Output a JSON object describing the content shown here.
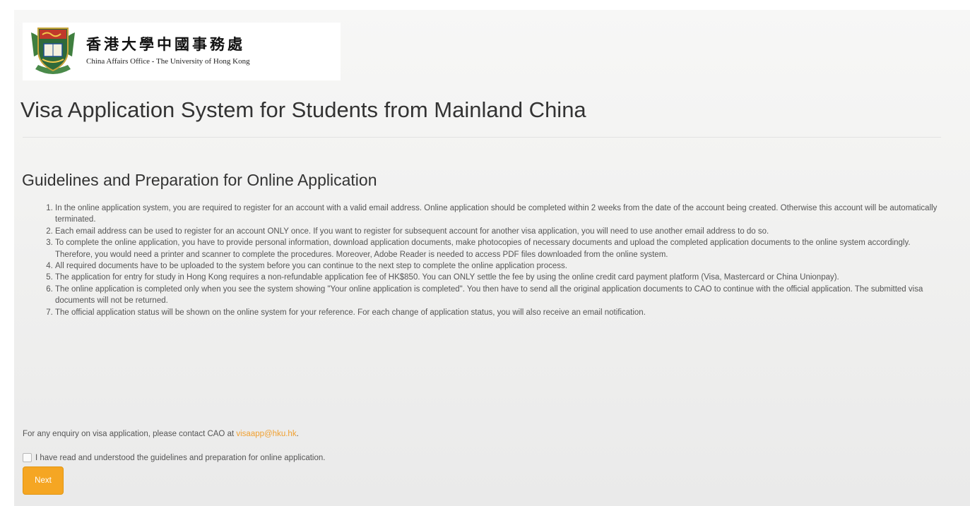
{
  "header": {
    "logo_chinese": "香港大學中國事務處",
    "logo_english": "China Affairs Office - The University of Hong Kong",
    "page_title": "Visa Application System for Students from Mainland China"
  },
  "main": {
    "section_heading": "Guidelines and Preparation for Online Application",
    "guidelines": [
      "In the online application system, you are required to register for an account with a valid email address. Online application should be completed within 2 weeks from the date of the account being created. Otherwise this account will be automatically terminated.",
      "Each email address can be used to register for an account ONLY once. If you want to register for subsequent account for another visa application, you will need to use another email address to do so.",
      "To complete the online application, you have to provide personal information, download application documents, make photocopies of necessary documents and upload the completed application documents to the online system accordingly. Therefore, you would need a printer and scanner to complete the procedures. Moreover, Adobe Reader is needed to access PDF files downloaded from the online system.",
      "All required documents have to be uploaded to the system before you can continue to the next step to complete the online application process.",
      "The application for entry for study in Hong Kong requires a non-refundable application fee of HK$850. You can ONLY settle the fee by using the online credit card payment platform (Visa, Mastercard or China Unionpay).",
      "The online application is completed only when you see the system showing \"Your online application is completed\". You then have to send all the original application documents to CAO to continue with the official application. The submitted visa documents will not be returned.",
      "The official application status will be shown on the online system for your reference. For each change of application status, you will also receive an email notification."
    ],
    "enquiry_text": "For any enquiry on visa application, please contact CAO at",
    "enquiry_email": "visaapp@hku.hk",
    "enquiry_end": ".",
    "agree_label": "I have read and understood the guidelines and preparation for online application.",
    "next_label": "Next"
  },
  "colors": {
    "accent": "#f5a623",
    "link": "#f0a030",
    "text": "#555555",
    "heading": "#333333"
  }
}
